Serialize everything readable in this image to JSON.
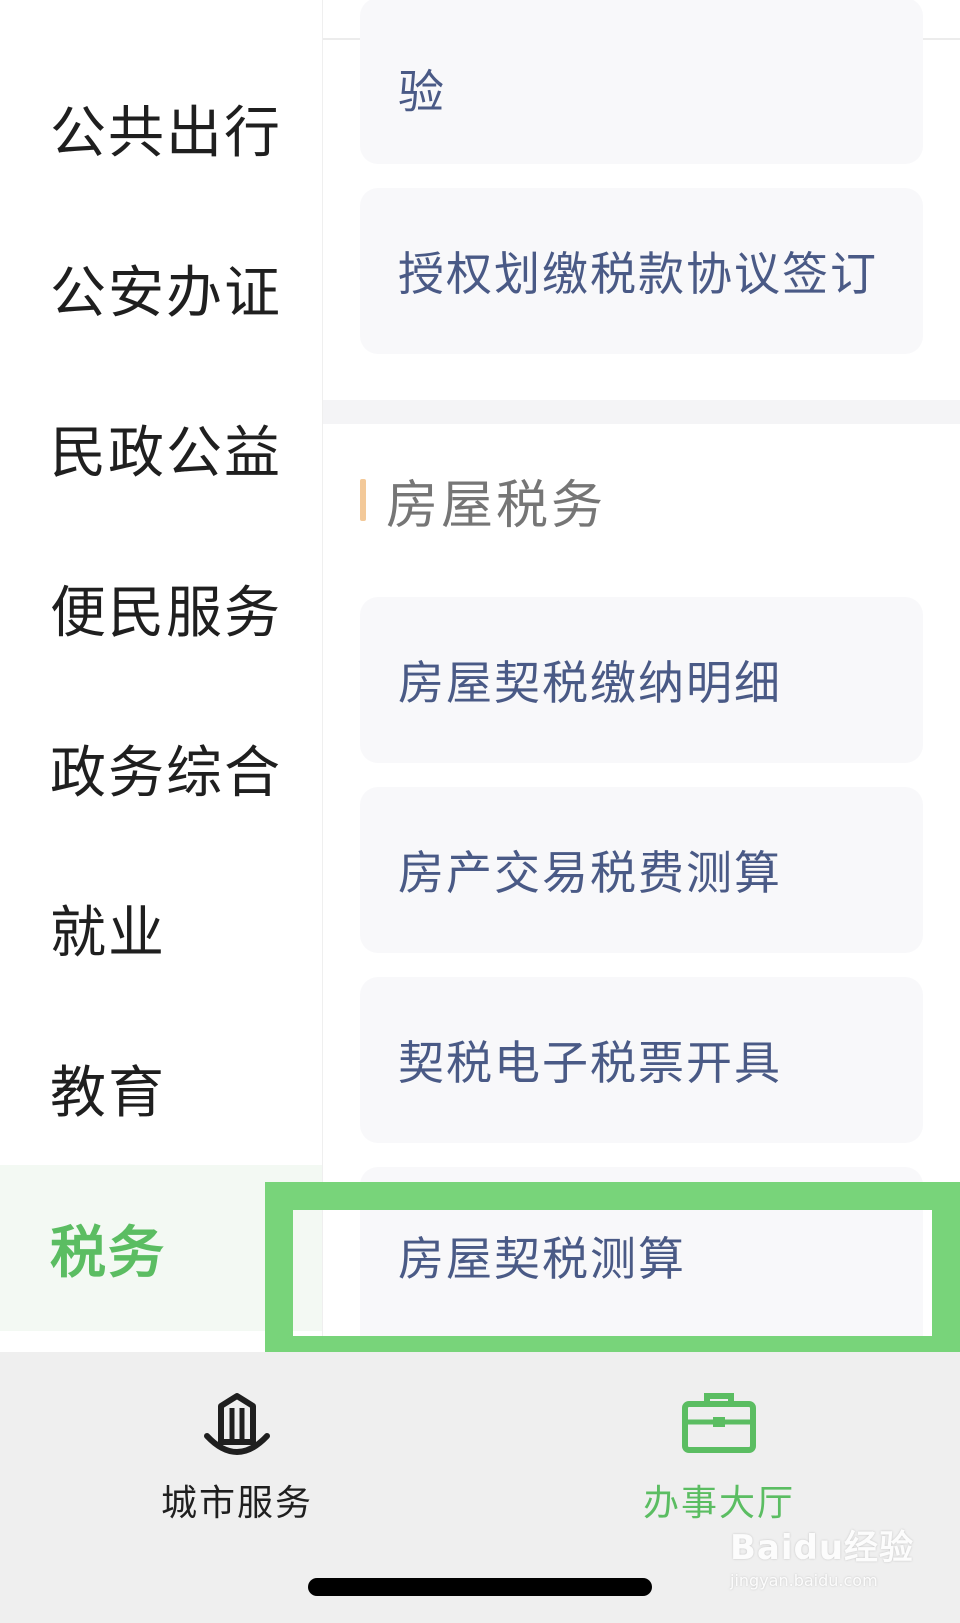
{
  "sidebar": {
    "items": [
      {
        "label": "公共出行"
      },
      {
        "label": "公安办证"
      },
      {
        "label": "民政公益"
      },
      {
        "label": "便民服务"
      },
      {
        "label": "政务综合"
      },
      {
        "label": "就业"
      },
      {
        "label": "教育"
      },
      {
        "label": "税务"
      }
    ],
    "active_label": "税务"
  },
  "content": {
    "cards_top": [
      {
        "label": "验"
      },
      {
        "label": "授权划缴税款协议签订"
      }
    ],
    "section": {
      "title": "房屋税务",
      "items": [
        {
          "label": "房屋契税缴纳明细"
        },
        {
          "label": "房产交易税费测算"
        },
        {
          "label": "契税电子税票开具"
        },
        {
          "label": "房屋契税测算"
        }
      ]
    }
  },
  "tabbar": {
    "tabs": [
      {
        "label": "城市服务",
        "icon": "city-buildings-icon",
        "active": false
      },
      {
        "label": "办事大厅",
        "icon": "briefcase-icon",
        "active": true
      }
    ]
  },
  "watermark": {
    "main": "Baidu经验",
    "sub": "jingyan.baidu.com"
  },
  "colors": {
    "accent_green": "#5bbd62",
    "highlight_green": "#78d47a",
    "card_text": "#4a5a86"
  }
}
